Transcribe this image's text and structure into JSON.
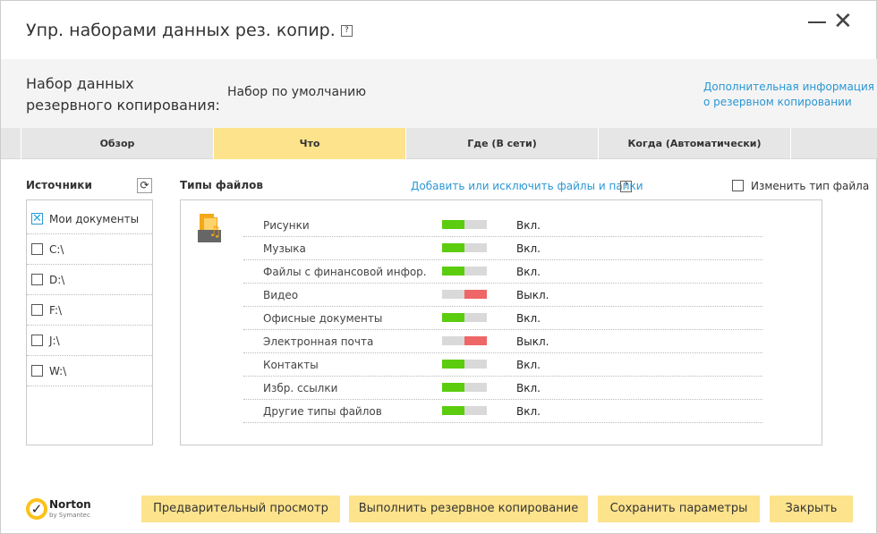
{
  "window": {
    "title": "Упр. наборами данных рез. копир.",
    "help": "?"
  },
  "header": {
    "set_label": "Набор данных\nрезервного копирования:",
    "set_value": "Набор по умолчанию",
    "info_link_1": "Дополнительная информация",
    "info_link_2": "о резервном копировании"
  },
  "tabs": [
    {
      "label": "Обзор",
      "active": false
    },
    {
      "label": "Что",
      "active": true
    },
    {
      "label": "Где (В сети)",
      "active": false
    },
    {
      "label": "Когда (Автоматически)",
      "active": false
    }
  ],
  "sources": {
    "title": "Источники",
    "items": [
      {
        "label": "Мои документы",
        "checked": true
      },
      {
        "label": "C:\\",
        "checked": false
      },
      {
        "label": "D:\\",
        "checked": false
      },
      {
        "label": "F:\\",
        "checked": false
      },
      {
        "label": "J:\\",
        "checked": false
      },
      {
        "label": "W:\\",
        "checked": false
      }
    ]
  },
  "file_types": {
    "title": "Типы файлов",
    "add_link": "Добавить или исключить файлы и папки",
    "help": "?",
    "change_type_label": "Изменить тип файла",
    "change_type_checked": false,
    "items": [
      {
        "label": "Рисунки",
        "on": true,
        "status": "Вкл."
      },
      {
        "label": "Музыка",
        "on": true,
        "status": "Вкл."
      },
      {
        "label": "Файлы с финансовой инфор.",
        "on": true,
        "status": "Вкл."
      },
      {
        "label": "Видео",
        "on": false,
        "status": "Выкл."
      },
      {
        "label": "Офисные документы",
        "on": true,
        "status": "Вкл."
      },
      {
        "label": "Электронная почта",
        "on": false,
        "status": "Выкл."
      },
      {
        "label": "Контакты",
        "on": true,
        "status": "Вкл."
      },
      {
        "label": "Избр. ссылки",
        "on": true,
        "status": "Вкл."
      },
      {
        "label": "Другие типы файлов",
        "on": true,
        "status": "Вкл."
      }
    ]
  },
  "colors": {
    "on": "#5ccc0e",
    "off": "#ee6666",
    "accent": "#fde38c",
    "link": "#2a97d4"
  },
  "logo": {
    "text": "Norton",
    "sub": "by Symantec"
  },
  "buttons": {
    "preview": "Предварительный просмотр",
    "run": "Выполнить резервное копирование",
    "save": "Сохранить параметры",
    "close": "Закрыть"
  }
}
